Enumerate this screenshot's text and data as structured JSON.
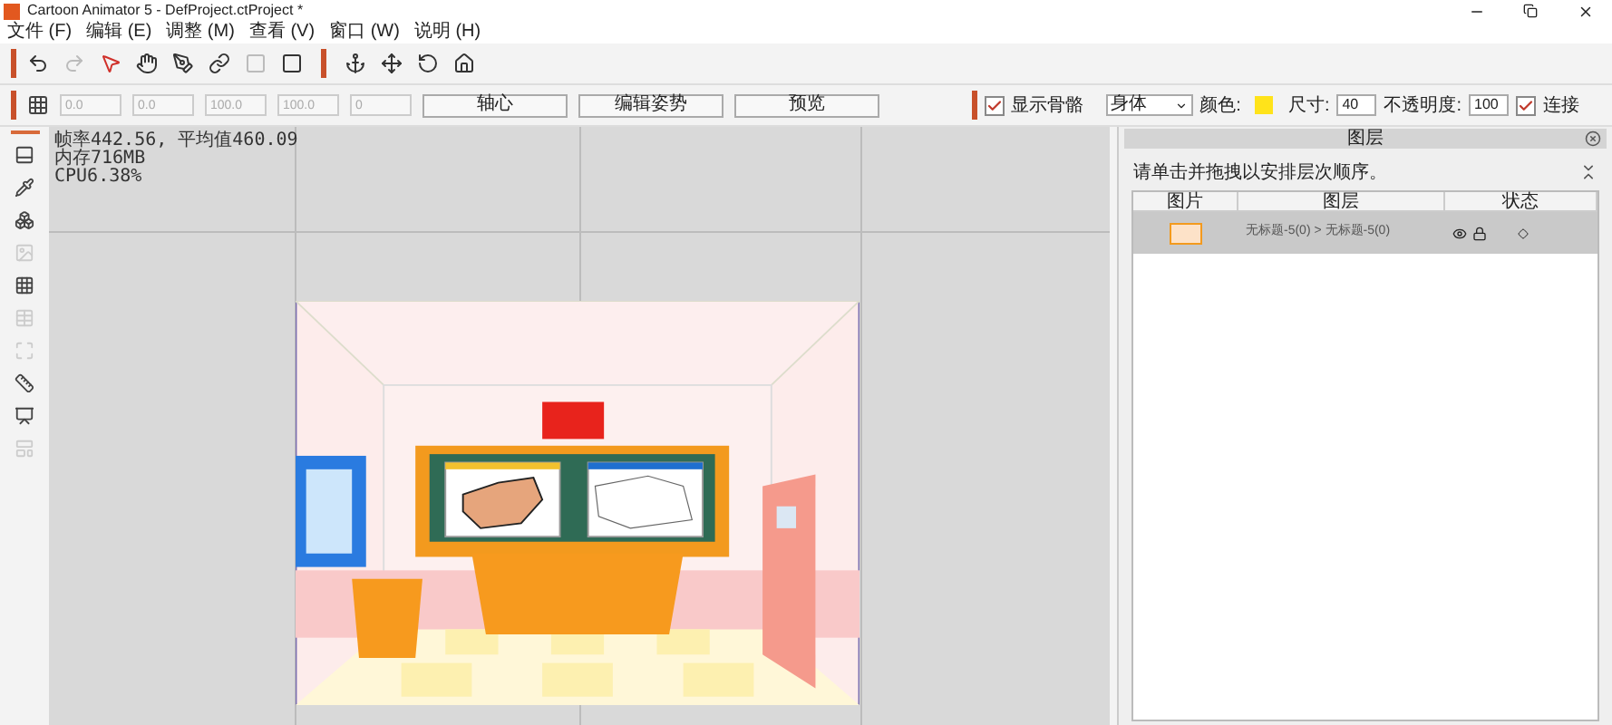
{
  "window": {
    "title": "Cartoon Animator 5 - DefProject.ctProject *"
  },
  "menu": [
    "文件 (F)",
    "编辑 (E)",
    "调整 (M)",
    "查看 (V)",
    "窗口 (W)",
    "说明 (H)"
  ],
  "toolbar": [
    {
      "kind": "undo",
      "disabled": false
    },
    {
      "kind": "redo",
      "disabled": true
    },
    {
      "kind": "select",
      "disabled": false
    },
    {
      "kind": "hand",
      "disabled": false
    },
    {
      "kind": "pen",
      "disabled": false
    },
    {
      "kind": "link",
      "disabled": false
    },
    {
      "kind": "square",
      "disabled": true
    },
    {
      "kind": "square",
      "disabled": false
    },
    {
      "kind": "anchor",
      "disabled": false
    },
    {
      "kind": "move",
      "disabled": false
    },
    {
      "kind": "rotate",
      "disabled": false
    },
    {
      "kind": "home",
      "disabled": false
    }
  ],
  "transform_fields": [
    "0.0",
    "0.0",
    "100.0",
    "100.0",
    "0"
  ],
  "transform_buttons": [
    "轴心",
    "编辑姿势",
    "预览"
  ],
  "bone_options": {
    "show_bones_label": "显示骨骼",
    "show_bones_checked": true,
    "part": "身体",
    "color_label": "颜色:",
    "color": "#ffe31a",
    "size_label": "尺寸:",
    "size": "40",
    "opacity_label": "不透明度:",
    "opacity": "100",
    "connect_label": "连接",
    "connect_checked": true
  },
  "left_tools": [
    {
      "disabled": false
    },
    {
      "disabled": false
    },
    {
      "disabled": false
    },
    {
      "disabled": true
    },
    {
      "disabled": false
    },
    {
      "disabled": true
    },
    {
      "disabled": true
    },
    {
      "disabled": false
    },
    {
      "disabled": false
    },
    {
      "disabled": true
    }
  ],
  "stats": [
    "帧率442.56, 平均值460.09",
    "内存716MB",
    "CPU6.38%"
  ],
  "layer_panel": {
    "title": "图层",
    "hint": "请单击并拖拽以安排层次顺序。",
    "columns": [
      "图片",
      "图层",
      "状态"
    ],
    "rows": [
      {
        "name": "无标题-5(0) > 无标题-5(0)",
        "selected": true
      }
    ]
  }
}
